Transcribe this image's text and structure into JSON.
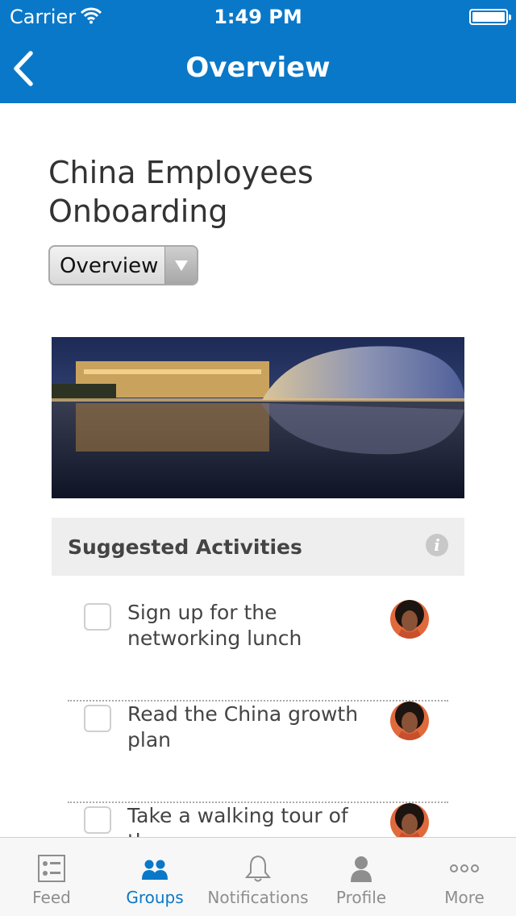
{
  "status_bar": {
    "carrier": "Carrier",
    "time": "1:49 PM"
  },
  "nav": {
    "title": "Overview"
  },
  "group": {
    "title": "China Employees Onboarding",
    "view_selector": "Overview"
  },
  "suggested_activities": {
    "title": "Suggested Activities",
    "items": [
      {
        "label": "Sign up for the networking lunch"
      },
      {
        "label": "Read the China growth plan"
      },
      {
        "label": "Take a walking tour of the"
      }
    ]
  },
  "tabs": [
    {
      "label": "Feed",
      "icon": "feed-icon"
    },
    {
      "label": "Groups",
      "icon": "groups-icon"
    },
    {
      "label": "Notifications",
      "icon": "bell-icon"
    },
    {
      "label": "Profile",
      "icon": "profile-icon"
    },
    {
      "label": "More",
      "icon": "more-icon"
    }
  ],
  "colors": {
    "brand_blue": "#0a78c8",
    "tab_inactive": "#8e8e8e"
  }
}
